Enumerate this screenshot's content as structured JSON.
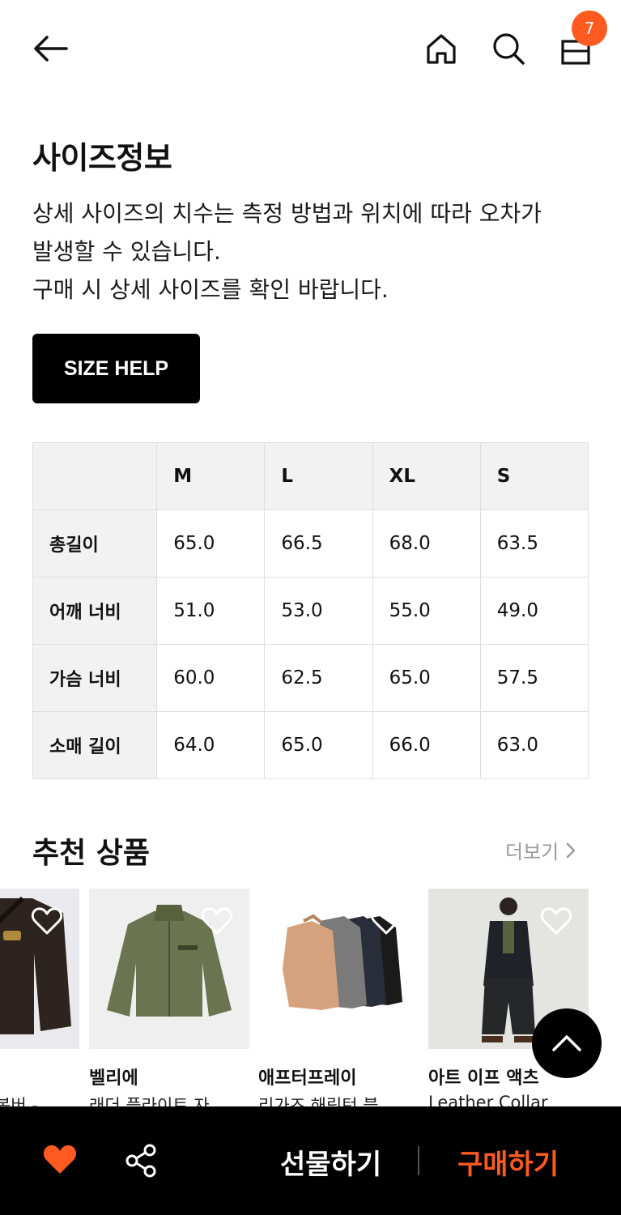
{
  "header": {
    "cart_count": "7"
  },
  "size_info": {
    "title": "사이즈정보",
    "desc_lines": [
      "상세 사이즈의 치수는 측정 방법과 위치에 따라 오차가",
      "발생할 수 있습니다.",
      "구매 시 상세 사이즈를 확인 바랍니다."
    ],
    "help_button": "SIZE HELP"
  },
  "size_table": {
    "columns": [
      "M",
      "L",
      "XL",
      "S"
    ],
    "rows": [
      {
        "label": "총길이",
        "values": [
          "65.0",
          "66.5",
          "68.0",
          "63.5"
        ]
      },
      {
        "label": "어깨 너비",
        "values": [
          "51.0",
          "53.0",
          "55.0",
          "49.0"
        ]
      },
      {
        "label": "가슴 너비",
        "values": [
          "60.0",
          "62.5",
          "65.0",
          "57.5"
        ]
      },
      {
        "label": "소매 길이",
        "values": [
          "64.0",
          "65.0",
          "66.0",
          "63.0"
        ]
      }
    ]
  },
  "recommend": {
    "title": "추천 상품",
    "more": "더보기",
    "items": [
      {
        "brand": "",
        "name": "봄버 -"
      },
      {
        "brand": "벨리에",
        "name": "래더 플라이트 자"
      },
      {
        "brand": "애프터프레이",
        "name": "리가즈 해링턴 블"
      },
      {
        "brand": "아트 이프 액츠",
        "name": "Leather Collar"
      }
    ]
  },
  "bottom": {
    "gift": "선물하기",
    "buy": "구매하기"
  },
  "colors": {
    "accent": "#ff5a1f",
    "bar": "#000000"
  }
}
